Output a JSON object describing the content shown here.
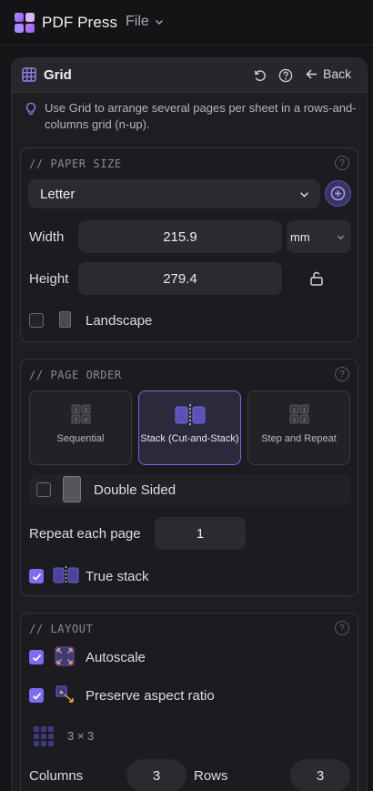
{
  "topbar": {
    "app_title": "PDF Press",
    "file_menu": "File"
  },
  "panel": {
    "title": "Grid",
    "back_label": "Back",
    "hint": "Use Grid to arrange several pages per sheet in a rows-and-columns grid (n-up)."
  },
  "paper_size": {
    "section_label": "// PAPER SIZE",
    "preset": "Letter",
    "width_label": "Width",
    "width_value": "215.9",
    "unit": "mm",
    "height_label": "Height",
    "height_value": "279.4",
    "landscape_label": "Landscape",
    "landscape_checked": false
  },
  "page_order": {
    "section_label": "// PAGE ORDER",
    "options": [
      "Sequential",
      "Stack (Cut-and-Stack)",
      "Step and Repeat"
    ],
    "selected": "Stack (Cut-and-Stack)",
    "double_sided_label": "Double Sided",
    "double_sided_checked": false,
    "repeat_label": "Repeat each page",
    "repeat_value": "1",
    "true_stack_label": "True stack",
    "true_stack_checked": true
  },
  "layout": {
    "section_label": "// LAYOUT",
    "autoscale_label": "Autoscale",
    "autoscale_checked": true,
    "preserve_label": "Preserve aspect ratio",
    "preserve_checked": true,
    "grid_summary": "3 × 3",
    "columns_label": "Columns",
    "columns_value": "3",
    "rows_label": "Rows",
    "rows_value": "3"
  },
  "colors": {
    "accent": "#7b6cf0",
    "background": "#151518",
    "panel": "#1e1e22"
  }
}
